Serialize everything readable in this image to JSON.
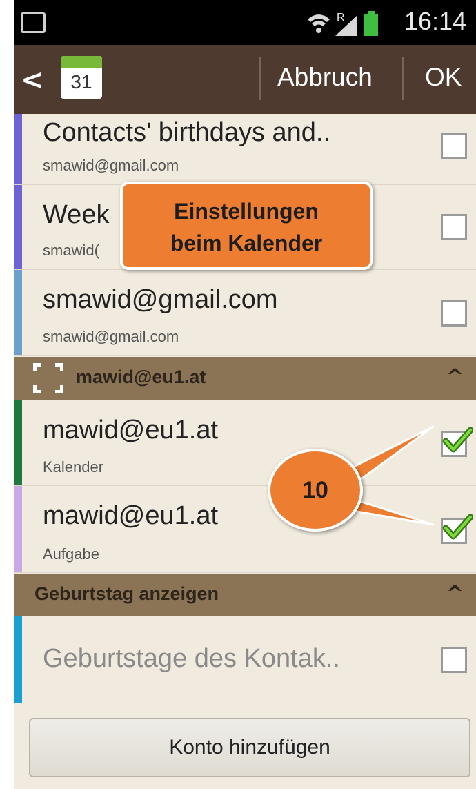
{
  "status_bar": {
    "time": "16:14",
    "network_letter": "R"
  },
  "action_bar": {
    "calendar_icon_number": "31",
    "cancel_label": "Abbruch",
    "ok_label": "OK"
  },
  "accounts": [
    {
      "title": "Contacts' birthdays and..",
      "subtitle": "smawid@gmail.com",
      "color": "#6b63d6",
      "checked": false
    },
    {
      "title": "Week",
      "subtitle": "smawid(",
      "color": "#6b63d6",
      "checked": false
    },
    {
      "title": "smawid@gmail.com",
      "subtitle": "smawid@gmail.com",
      "color": "#6ca0cc",
      "checked": false
    }
  ],
  "group_mawid": {
    "title": "mawid@eu1.at"
  },
  "mawid_items": [
    {
      "title": "mawid@eu1.at",
      "subtitle": "Kalender",
      "color": "#1e7a3c",
      "checked": true
    },
    {
      "title": "mawid@eu1.at",
      "subtitle": "Aufgabe",
      "color": "#c9a8e8",
      "checked": true
    }
  ],
  "group_birthday": {
    "title": "Geburtstag anzeigen"
  },
  "birthday_item": {
    "title": "Geburtstage des Kontak..",
    "color": "#1aa0d0",
    "checked": false
  },
  "add_account_label": "Konto hinzufügen",
  "annotation": {
    "callout_line1": "Einstellungen",
    "callout_line2": "beim Kalender",
    "badge_number": "10",
    "color": "#ed7d31"
  }
}
